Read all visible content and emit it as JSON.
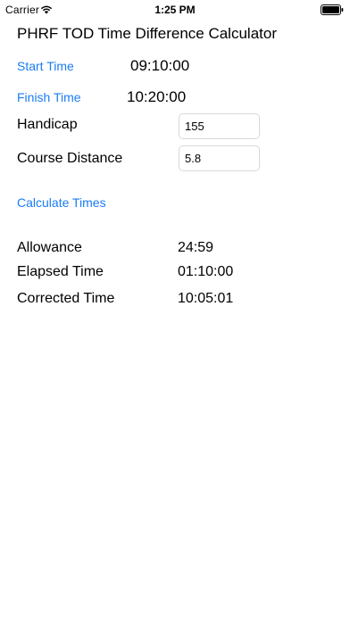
{
  "status_bar": {
    "carrier": "Carrier",
    "time": "1:25 PM",
    "wifi_icon": "wifi-icon",
    "battery_icon": "battery-full-icon"
  },
  "title": "PHRF TOD Time Difference Calculator",
  "start": {
    "label": "Start Time",
    "value": "09:10:00"
  },
  "finish": {
    "label": "Finish Time",
    "value": "10:20:00"
  },
  "handicap": {
    "label": "Handicap",
    "value": "155"
  },
  "course_distance": {
    "label": "Course Distance",
    "value": "5.8"
  },
  "calculate_label": "Calculate Times",
  "results": {
    "allowance": {
      "label": "Allowance",
      "value": "24:59"
    },
    "elapsed": {
      "label": "Elapsed Time",
      "value": "01:10:00"
    },
    "corrected": {
      "label": "Corrected Time",
      "value": "10:05:01"
    }
  },
  "colors": {
    "link": "#1a7cf3"
  }
}
